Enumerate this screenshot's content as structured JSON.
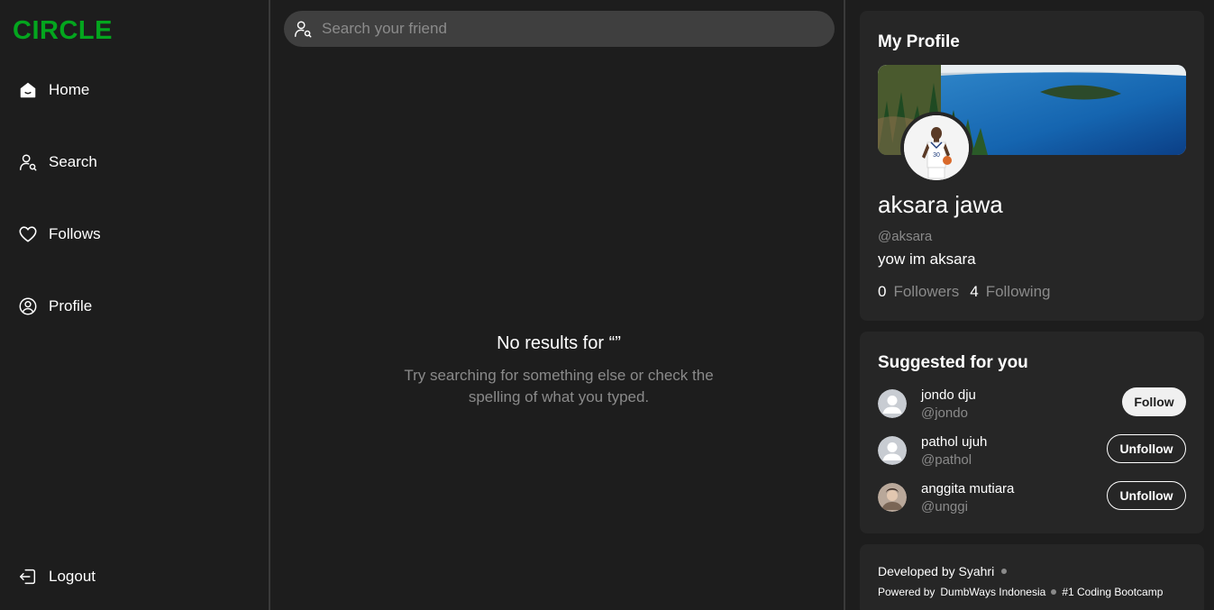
{
  "app": {
    "logo": "CIRCLE",
    "brand_color": "#04a51e"
  },
  "sidebar": {
    "items": [
      {
        "label": "Home",
        "icon": "home-icon"
      },
      {
        "label": "Search",
        "icon": "user-search-icon"
      },
      {
        "label": "Follows",
        "icon": "heart-icon"
      },
      {
        "label": "Profile",
        "icon": "user-circle-icon"
      }
    ],
    "logout": {
      "label": "Logout",
      "icon": "logout-icon"
    }
  },
  "search": {
    "placeholder": "Search your friend",
    "value": "",
    "icon": "user-search-icon"
  },
  "empty_state": {
    "title": "No results for “”",
    "subtitle": "Try searching for something else or check the spelling of what you typed."
  },
  "profile": {
    "title": "My Profile",
    "name": "aksara jawa",
    "handle": "@aksara",
    "bio": "yow im aksara",
    "followers_count": "0",
    "followers_label": "Followers",
    "following_count": "4",
    "following_label": "Following"
  },
  "suggestions": {
    "title": "Suggested for you",
    "items": [
      {
        "name": "jondo dju",
        "handle": "@jondo",
        "action": "Follow",
        "avatar": "default-avatar-icon"
      },
      {
        "name": "pathol ujuh",
        "handle": "@pathol",
        "action": "Unfollow",
        "avatar": "default-avatar-icon"
      },
      {
        "name": "anggita mutiara",
        "handle": "@unggi",
        "action": "Unfollow",
        "avatar": "photo-avatar"
      }
    ]
  },
  "footer": {
    "developed_by": "Developed by Syahri",
    "powered_by_label": "Powered by",
    "powered_by_org": "DumbWays Indonesia",
    "tagline": "#1 Coding Bootcamp"
  }
}
